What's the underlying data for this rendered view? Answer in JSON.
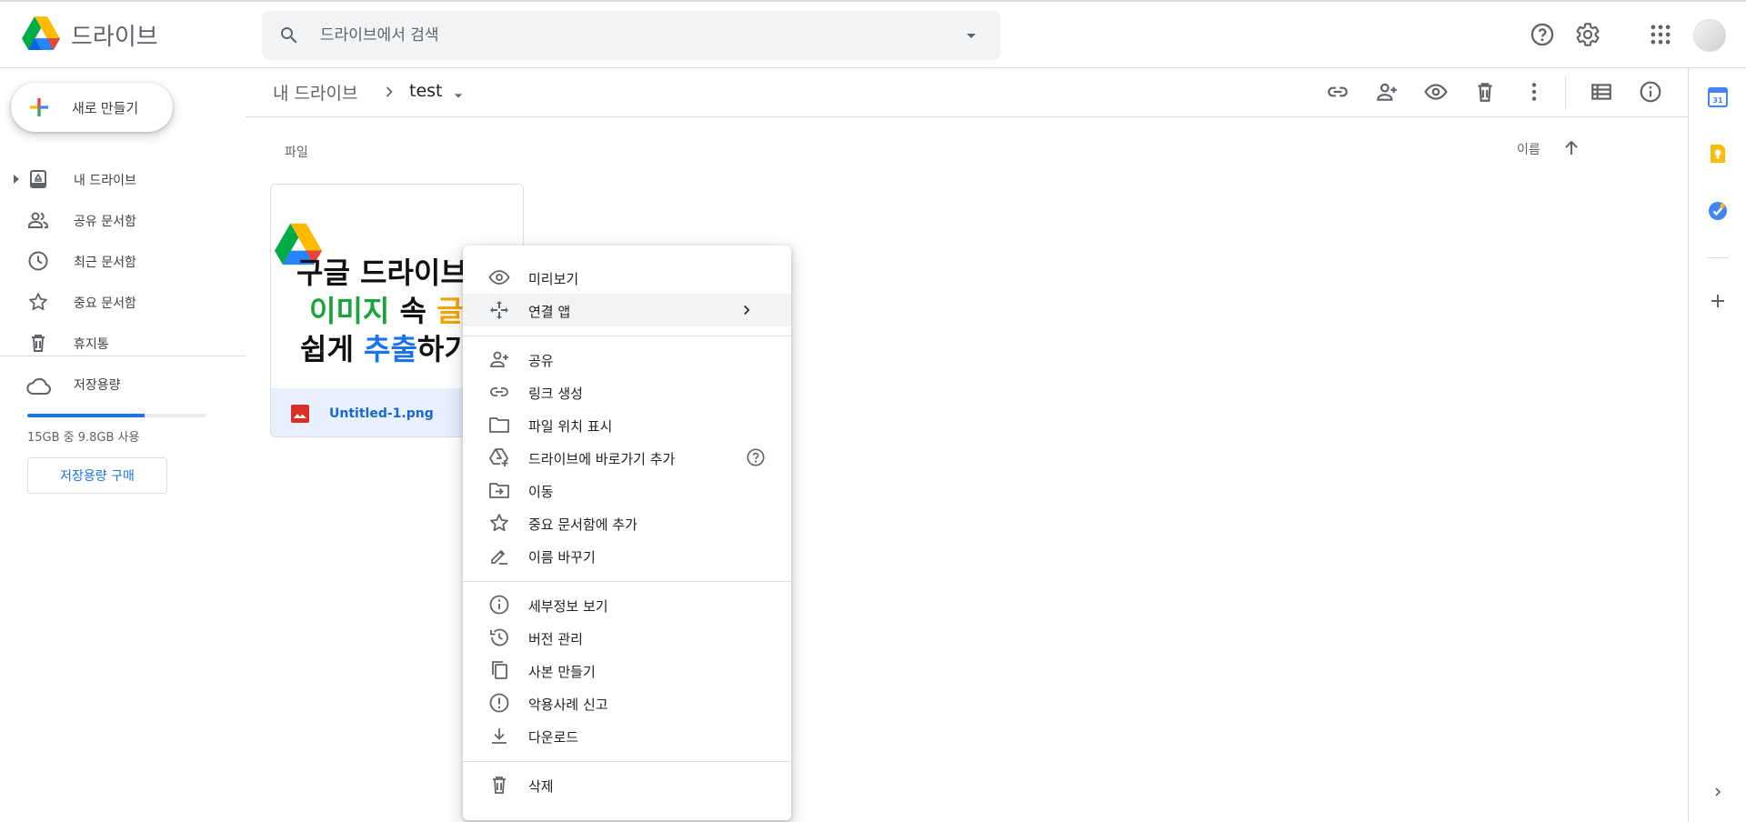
{
  "app": {
    "title": "드라이브"
  },
  "search": {
    "placeholder": "드라이브에서 검색"
  },
  "sidebar": {
    "new_label": "새로 만들기",
    "items": [
      {
        "label": "내 드라이브",
        "icon": "my-drive-icon"
      },
      {
        "label": "공유 문서함",
        "icon": "people-icon"
      },
      {
        "label": "최근 문서함",
        "icon": "clock-icon"
      },
      {
        "label": "중요 문서함",
        "icon": "star-icon"
      },
      {
        "label": "휴지통",
        "icon": "trash-icon"
      }
    ],
    "storage": {
      "title": "저장용량",
      "usage_text": "15GB 중 9.8GB 사용",
      "used_fraction": 0.653,
      "buy_label": "저장용량 구매"
    }
  },
  "breadcrumb": {
    "root": "내 드라이브",
    "current": "test"
  },
  "content": {
    "section_label": "파일",
    "sort_label": "이름",
    "file": {
      "name": "Untitled-1.png",
      "thumbnail_lines": [
        "구글 드라이브",
        "이미지 속 글",
        "쉽게 추출하기"
      ]
    }
  },
  "context_menu": {
    "groups": [
      [
        {
          "label": "미리보기",
          "icon": "eye-icon"
        },
        {
          "label": "연결 앱",
          "icon": "open-with-icon",
          "submenu": true
        }
      ],
      [
        {
          "label": "공유",
          "icon": "person-add-icon"
        },
        {
          "label": "링크 생성",
          "icon": "link-icon"
        },
        {
          "label": "파일 위치 표시",
          "icon": "folder-icon"
        },
        {
          "label": "드라이브에 바로가기 추가",
          "icon": "drive-shortcut-icon",
          "help": true
        },
        {
          "label": "이동",
          "icon": "move-icon"
        },
        {
          "label": "중요 문서함에 추가",
          "icon": "star-icon"
        },
        {
          "label": "이름 바꾸기",
          "icon": "pencil-icon"
        }
      ],
      [
        {
          "label": "세부정보 보기",
          "icon": "info-icon"
        },
        {
          "label": "버전 관리",
          "icon": "history-icon"
        },
        {
          "label": "사본 만들기",
          "icon": "copy-icon"
        },
        {
          "label": "악용사례 신고",
          "icon": "report-icon"
        },
        {
          "label": "다운로드",
          "icon": "download-icon"
        }
      ],
      [
        {
          "label": "삭제",
          "icon": "trash-icon"
        }
      ]
    ]
  },
  "colors": {
    "accent": "#1a73e8",
    "selected_file_bg": "#e8f0fe",
    "menu_hover": "#f1f3f4",
    "thumbnail_green": "#1aa33a",
    "thumbnail_yellow": "#f5a300",
    "thumbnail_blue": "#1a73e8"
  }
}
